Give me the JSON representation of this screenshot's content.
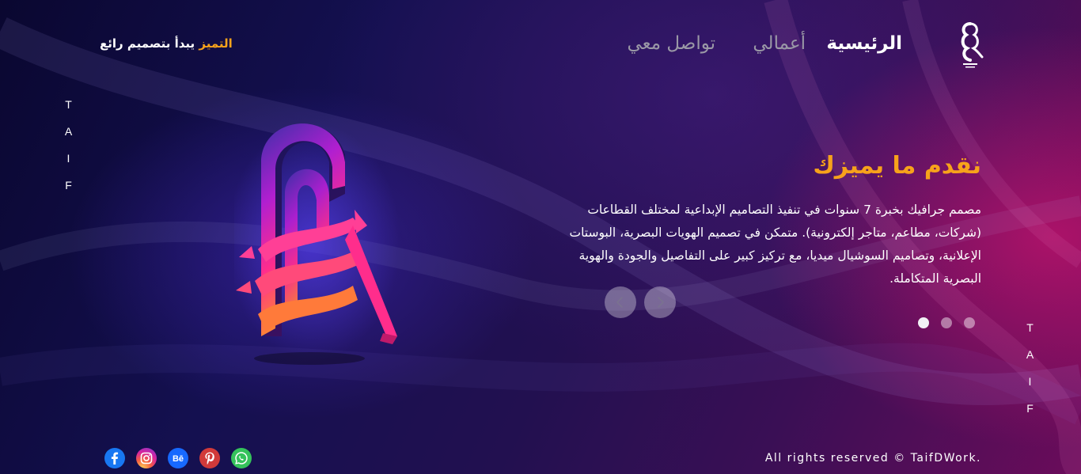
{
  "brand": {
    "logo_icon": "taif-calligraphy-logo-icon"
  },
  "nav": {
    "items": [
      {
        "id": "home",
        "label": "الرئيسية",
        "active": true
      },
      {
        "id": "works",
        "label": "أعمالي",
        "active": false
      },
      {
        "id": "contact",
        "label": "تواصل معي",
        "active": false
      }
    ]
  },
  "tagline": {
    "highlight": "التميز",
    "rest": " يبدأ بتصميم رائع"
  },
  "side_text": {
    "left": [
      "T",
      "A",
      "I",
      "F"
    ],
    "right": [
      "T",
      "A",
      "I",
      "F"
    ]
  },
  "hero": {
    "title": "نقدم ما يميزك",
    "description": "مصمم جرافيك بخبرة 7 سنوات في تنفيذ التصاميم الإبداعية لمختلف القطاعات (شركات، مطاعم، متاجر إلكترونية). متمكن في تصميم الهويات البصرية، البوستات الإعلانية، وتصاميم السوشيال ميديا، مع تركيز كبير على التفاصيل والجودة والهوية البصرية المتكاملة.",
    "image_icon": "taif-3d-calligraphy-logo"
  },
  "slider": {
    "prev_icon": "chevron-left-icon",
    "next_icon": "chevron-right-icon",
    "dot_count": 3,
    "active_index": 0
  },
  "footer": {
    "copyright": "All rights reserved © TaifDWork.",
    "social": [
      "facebook-icon",
      "instagram-icon",
      "behance-icon",
      "pinterest-icon",
      "whatsapp-icon"
    ]
  },
  "colors": {
    "accent": "#f7a21b",
    "background_dark": "#141050",
    "background_magenta": "#6b0c5a",
    "text": "#ffffff",
    "nav_inactive": "#9a98a6"
  }
}
